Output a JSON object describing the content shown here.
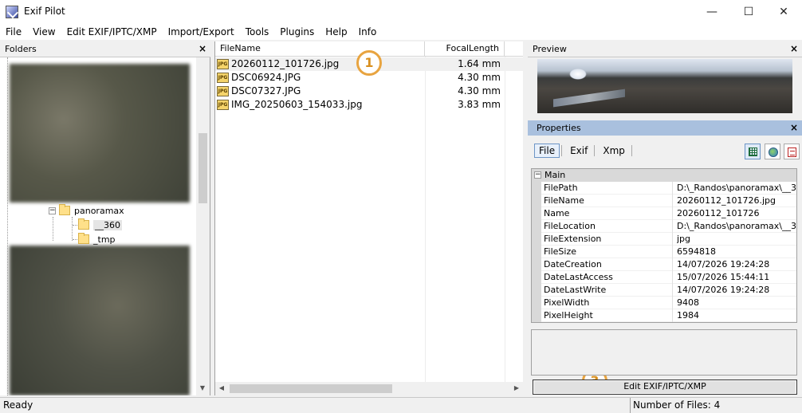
{
  "window": {
    "title": "Exif Pilot",
    "minimize": "—",
    "maximize": "☐",
    "close": "✕"
  },
  "menu": [
    "File",
    "View",
    "Edit EXIF/IPTC/XMP",
    "Import/Export",
    "Tools",
    "Plugins",
    "Help",
    "Info"
  ],
  "folders": {
    "title": "Folders",
    "close": "×",
    "tree": [
      {
        "label": "panoramax",
        "expander": "−"
      },
      {
        "label": "__360",
        "selected": true
      },
      {
        "label": "_tmp"
      }
    ]
  },
  "filelist": {
    "columns": [
      "FileName",
      "FocalLength"
    ],
    "rows": [
      {
        "name": "20260112_101726.jpg",
        "focal": "1.64 mm",
        "selected": true
      },
      {
        "name": "DSC06924.JPG",
        "focal": "4.30 mm"
      },
      {
        "name": "DSC07327.JPG",
        "focal": "4.30 mm"
      },
      {
        "name": "IMG_20250603_154033.jpg",
        "focal": "3.83 mm"
      }
    ],
    "file_icon_text": "JPG"
  },
  "callouts": [
    "1",
    "2",
    "3"
  ],
  "preview": {
    "title": "Preview",
    "close": "×"
  },
  "properties": {
    "title": "Properties",
    "close": "×",
    "tabs": [
      "File",
      "Exif",
      "Xmp"
    ],
    "active_tab": "File",
    "toolbar_icons": [
      "grid-icon",
      "globe-icon",
      "note-icon"
    ],
    "category": "Main",
    "category_expander": "−",
    "rows": [
      {
        "key": "FilePath",
        "value": "D:\\_Randos\\panoramax\\__3..."
      },
      {
        "key": "FileName",
        "value": "20260112_101726.jpg"
      },
      {
        "key": "Name",
        "value": "20260112_101726"
      },
      {
        "key": "FileLocation",
        "value": "D:\\_Randos\\panoramax\\__3..."
      },
      {
        "key": "FileExtension",
        "value": "jpg"
      },
      {
        "key": "FileSize",
        "value": "6594818"
      },
      {
        "key": "DateCreation",
        "value": "14/07/2026 19:24:28"
      },
      {
        "key": "DateLastAccess",
        "value": "15/07/2026 15:44:11"
      },
      {
        "key": "DateLastWrite",
        "value": "14/07/2026 19:24:28"
      },
      {
        "key": "PixelWidth",
        "value": "9408"
      },
      {
        "key": "PixelHeight",
        "value": "1984"
      }
    ],
    "edit_button": "Edit EXIF/IPTC/XMP"
  },
  "status": {
    "left": "Ready",
    "right": "Number of Files: 4"
  },
  "colors": {
    "properties_header": "#a9c0de",
    "callout": "#e8a440"
  }
}
